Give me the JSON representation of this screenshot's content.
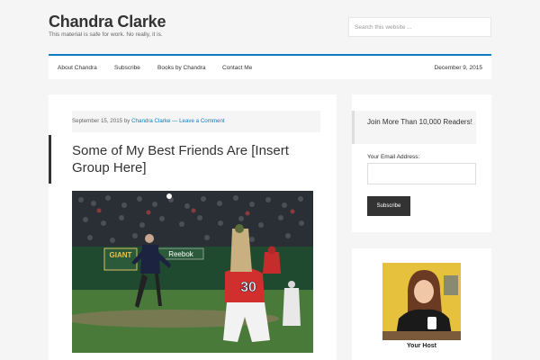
{
  "site": {
    "title": "Chandra Clarke",
    "description": "This material is safe for work. No really, it is.",
    "search_placeholder": "Search this website ..."
  },
  "nav": {
    "items": [
      "About Chandra",
      "Subscribe",
      "Books by Chandra",
      "Contact Me"
    ],
    "date": "December 9, 2015"
  },
  "post": {
    "date": "September 15, 2015",
    "by": "by",
    "author": "Chandra Clarke",
    "separator": "—",
    "comment_link": "Leave a Comment",
    "title": "Some of My Best Friends Are [Insert Group Here]",
    "image_signs": {
      "sign1": "GIANT",
      "sign2": "Reebok",
      "jersey_number": "30"
    }
  },
  "widgets": {
    "newsletter": {
      "heading": "Join More Than 10,000 Readers!",
      "email_label": "Your Email Address:",
      "button": "Subscribe"
    },
    "host": {
      "caption": "Your Host"
    }
  },
  "colors": {
    "accent": "#0e7dc2",
    "background": "#f5f5f5",
    "button": "#333333"
  }
}
